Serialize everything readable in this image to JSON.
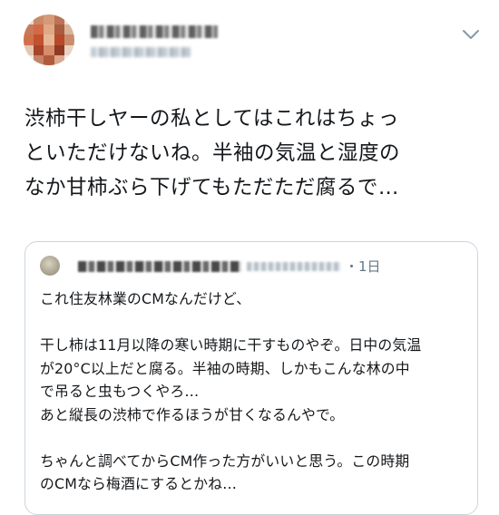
{
  "tweet": {
    "text_lines": [
      "渋柿干しヤーの私としてはこれはちょっ",
      "といただけないね。半袖の気温と湿度の",
      "なか甘柿ぶら下げてもただただ腐るで…"
    ]
  },
  "quoted": {
    "time": "・1日",
    "lines": [
      "これ住友林業のCMなんだけど、",
      "",
      "干し柿は11月以降の寒い時期に干すものやぞ。日中の気温",
      "が20°C以上だと腐る。半袖の時期、しかもこんな林の中",
      "で吊ると虫もつくやろ…",
      "あと縦長の渋柿で作るほうが甘くなるんやで。",
      "",
      "ちゃんと調べてからCM作った方がいいと思う。この時期",
      "のCMなら梅酒にするとかね…"
    ]
  },
  "icons": {
    "menu": "chevron-down-icon"
  },
  "colors": {
    "text": "#14171a",
    "muted": "#657786",
    "border": "#ccd6dd",
    "chevron": "#8899a6"
  }
}
